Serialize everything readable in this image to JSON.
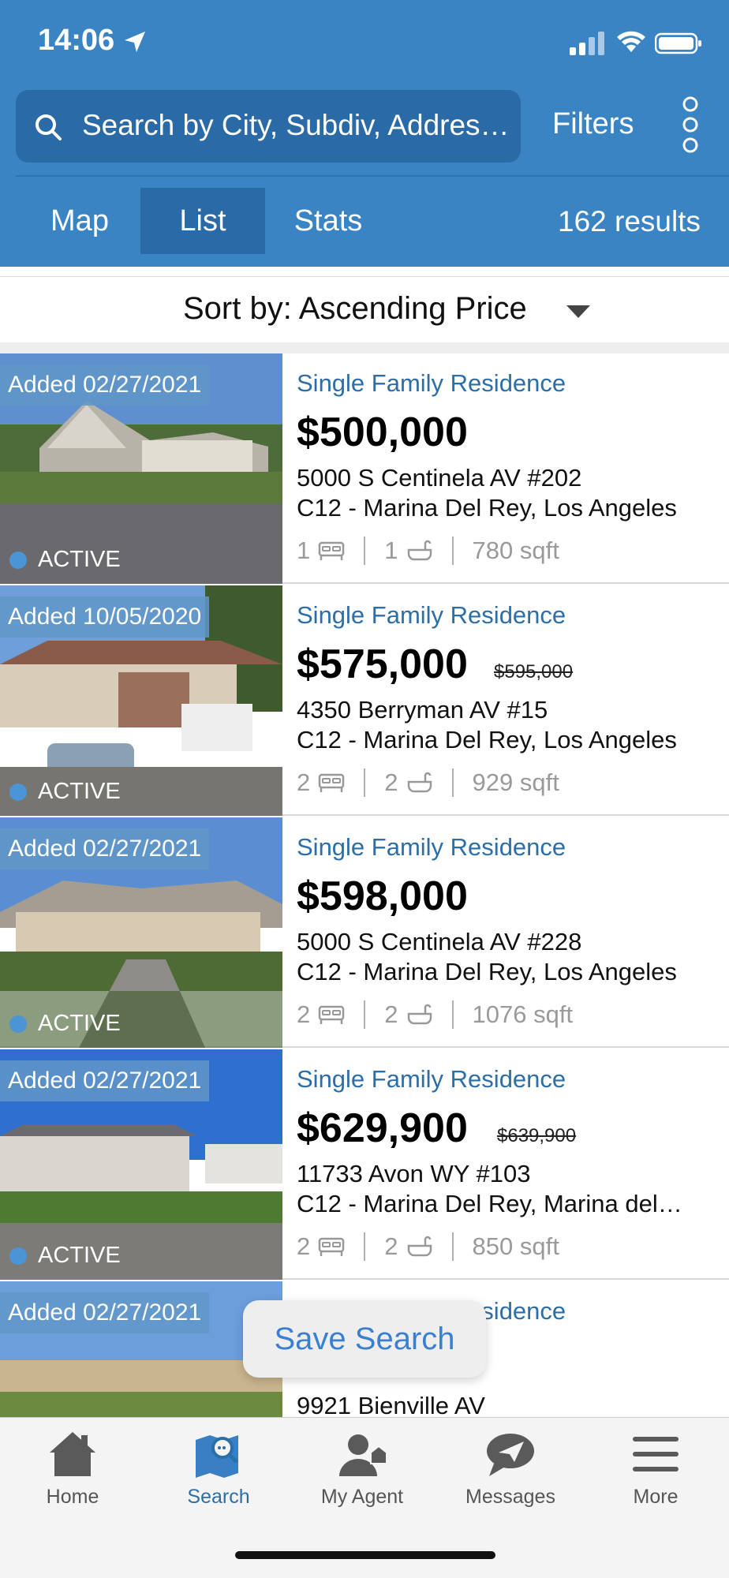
{
  "status_bar": {
    "time": "14:06"
  },
  "search": {
    "placeholder": "Search by City, Subdiv, Addres…",
    "filters_label": "Filters"
  },
  "view_tabs": [
    {
      "label": "Map"
    },
    {
      "label": "List"
    },
    {
      "label": "Stats"
    }
  ],
  "results_text": "162 results",
  "sort": {
    "label": "Sort by: Ascending Price"
  },
  "listings": [
    {
      "added": "Added 02/27/2021",
      "status": "ACTIVE",
      "type": "Single Family Residence",
      "price": "$500,000",
      "old_price": "",
      "address_line1": "5000 S Centinela AV #202",
      "address_line2": "C12 - Marina Del Rey, Los Angeles",
      "beds": "1",
      "baths": "1",
      "sqft": "780 sqft"
    },
    {
      "added": "Added 10/05/2020",
      "status": "ACTIVE",
      "type": "Single Family Residence",
      "price": "$575,000",
      "old_price": "$595,000",
      "address_line1": "4350 Berryman AV #15",
      "address_line2": "C12 - Marina Del Rey, Los Angeles",
      "beds": "2",
      "baths": "2",
      "sqft": "929 sqft"
    },
    {
      "added": "Added 02/27/2021",
      "status": "ACTIVE",
      "type": "Single Family Residence",
      "price": "$598,000",
      "old_price": "",
      "address_line1": "5000 S Centinela AV #228",
      "address_line2": "C12 - Marina Del Rey, Los Angeles",
      "beds": "2",
      "baths": "2",
      "sqft": "1076 sqft"
    },
    {
      "added": "Added 02/27/2021",
      "status": "ACTIVE",
      "type": "Single Family Residence",
      "price": "$629,900",
      "old_price": "$639,900",
      "address_line1": "11733 Avon WY #103",
      "address_line2": "C12 - Marina Del Rey, Marina del…",
      "beds": "2",
      "baths": "2",
      "sqft": "850 sqft"
    },
    {
      "added": "Added 02/27/2021",
      "status": "",
      "type": "Single Family Residence",
      "price": "",
      "old_price": "",
      "address_line1": "9921 Bienville AV",
      "address_line2": "",
      "beds": "",
      "baths": "",
      "sqft": ""
    }
  ],
  "save_search_label": "Save Search",
  "bottom_nav": [
    {
      "label": "Home"
    },
    {
      "label": "Search"
    },
    {
      "label": "My Agent"
    },
    {
      "label": "Messages"
    },
    {
      "label": "More"
    }
  ],
  "colors": {
    "header_blue": "#3a84c4",
    "accent_blue": "#2c6ea8",
    "active_tab": "#2a6aa7"
  }
}
